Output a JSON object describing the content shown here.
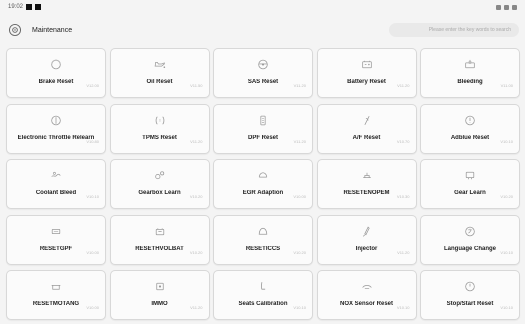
{
  "statusbar": {
    "time": "19:02"
  },
  "header": {
    "title": "Maintenance",
    "search_placeholder": "Please enter the key words to search"
  },
  "tiles": [
    {
      "label": "Brake Reset",
      "version": "V12.00",
      "icon": "brake-icon"
    },
    {
      "label": "Oil Reset",
      "version": "V11.50",
      "icon": "oil-icon"
    },
    {
      "label": "SAS Reset",
      "version": "V11.20",
      "icon": "steering-icon"
    },
    {
      "label": "Battery Reset",
      "version": "V11.20",
      "icon": "battery-icon"
    },
    {
      "label": "Bleeding",
      "version": "V11.00",
      "icon": "bleeding-icon"
    },
    {
      "label": "Electronic Throttle Relearn",
      "version": "V10.80",
      "icon": "throttle-icon"
    },
    {
      "label": "TPMS Reset",
      "version": "V11.20",
      "icon": "tire-icon"
    },
    {
      "label": "DPF Reset",
      "version": "V11.20",
      "icon": "dpf-icon"
    },
    {
      "label": "A/F Reset",
      "version": "V10.70",
      "icon": "af-icon"
    },
    {
      "label": "Adblue Reset",
      "version": "V10.10",
      "icon": "adblue-icon"
    },
    {
      "label": "Coolant Bleed",
      "version": "V10.10",
      "icon": "coolant-icon"
    },
    {
      "label": "Gearbox Learn",
      "version": "V10.20",
      "icon": "gearbox-icon"
    },
    {
      "label": "EGR Adaption",
      "version": "V10.00",
      "icon": "egr-icon"
    },
    {
      "label": "RESETENOPEM",
      "version": "V10.30",
      "icon": "engine-icon"
    },
    {
      "label": "Gear Learn",
      "version": "V10.20",
      "icon": "gear-learn-icon"
    },
    {
      "label": "RESETGPF",
      "version": "V10.00",
      "icon": "gpf-icon"
    },
    {
      "label": "RESETHVOLBAT",
      "version": "V10.20",
      "icon": "hv-battery-icon"
    },
    {
      "label": "RESETICCS",
      "version": "V10.20",
      "icon": "iccs-icon"
    },
    {
      "label": "Injector",
      "version": "V11.20",
      "icon": "injector-icon"
    },
    {
      "label": "Language Change",
      "version": "V10.10",
      "icon": "language-icon"
    },
    {
      "label": "RESETMOTANG",
      "version": "V10.00",
      "icon": "motor-icon"
    },
    {
      "label": "IMMO",
      "version": "V11.20",
      "icon": "immo-icon"
    },
    {
      "label": "Seats Calibration",
      "version": "V10.10",
      "icon": "seat-icon"
    },
    {
      "label": "NOX Sensor Reset",
      "version": "V10.10",
      "icon": "nox-icon"
    },
    {
      "label": "Stop/Start Reset",
      "version": "V10.10",
      "icon": "stop-start-icon"
    }
  ]
}
